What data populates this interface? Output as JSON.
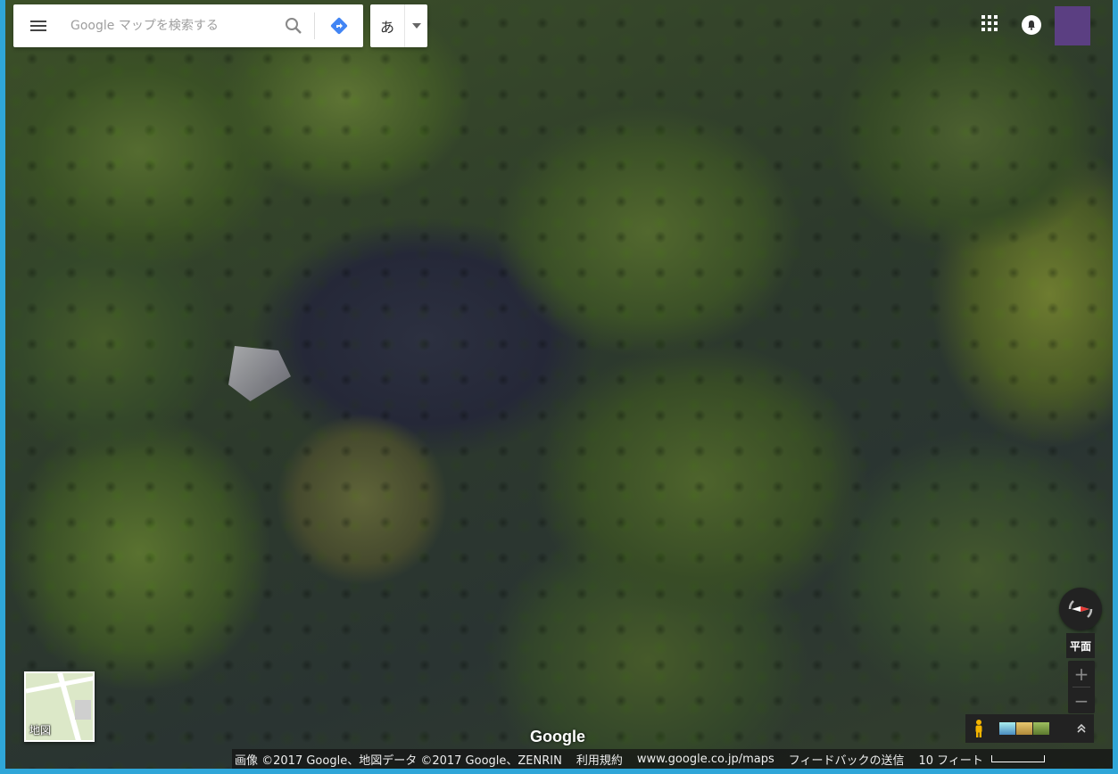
{
  "search": {
    "placeholder": "Google マップを検索する"
  },
  "ime": {
    "char": "あ"
  },
  "tilt": {
    "label": "平面"
  },
  "minimap": {
    "label": "地図"
  },
  "logo": {
    "text": "Google"
  },
  "footer": {
    "imagery": "画像 ©2017 Google、地図データ ©2017 Google、ZENRIN",
    "terms": "利用規約",
    "url": "www.google.co.jp/maps",
    "feedback": "フィードバックの送信",
    "scale": "10 フィート"
  },
  "colors": {
    "avatar": "#5b3f82",
    "directions": "#4285f4",
    "compass_needle": "#e53935",
    "window_border": "#2fa6d8"
  },
  "icons": {
    "menu": "hamburger-icon",
    "search": "search-icon",
    "directions": "directions-icon",
    "apps": "apps-grid-icon",
    "notifications": "bell-icon",
    "compass": "compass-icon",
    "pegman": "pegman-icon",
    "expand": "chevron-up-icon"
  }
}
